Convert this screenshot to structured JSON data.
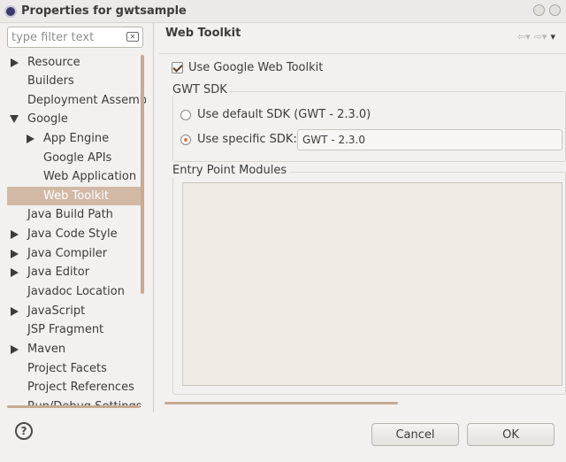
{
  "window": {
    "title": "Properties for gwtsample"
  },
  "filter": {
    "placeholder": "type filter text"
  },
  "nav": {
    "items": [
      {
        "label": "Resource"
      },
      {
        "label": "Builders"
      },
      {
        "label": "Deployment Assemb"
      },
      {
        "label": "Google"
      },
      {
        "label": "App Engine"
      },
      {
        "label": "Google APIs"
      },
      {
        "label": "Web Application"
      },
      {
        "label": "Web Toolkit"
      },
      {
        "label": "Java Build Path"
      },
      {
        "label": "Java Code Style"
      },
      {
        "label": "Java Compiler"
      },
      {
        "label": "Java Editor"
      },
      {
        "label": "Javadoc Location"
      },
      {
        "label": "JavaScript"
      },
      {
        "label": "JSP Fragment"
      },
      {
        "label": "Maven"
      },
      {
        "label": "Project Facets"
      },
      {
        "label": "Project References"
      },
      {
        "label": "Run/Debug Settings"
      }
    ],
    "selected": "Web Toolkit"
  },
  "page": {
    "title": "Web Toolkit",
    "use_gwt_label": "Use Google Web Toolkit",
    "gwt_sdk_group": "GWT SDK",
    "use_default_sdk": "Use default SDK (GWT - 2.3.0)",
    "use_specific_sdk": "Use specific SDK:",
    "sdk_selected": "GWT - 2.3.0",
    "entry_point_group": "Entry Point Modules"
  },
  "footer": {
    "help": "?",
    "cancel": "Cancel",
    "ok": "OK"
  },
  "colors": {
    "selection": "#d1b9a6",
    "accent": "#e07a3b"
  }
}
